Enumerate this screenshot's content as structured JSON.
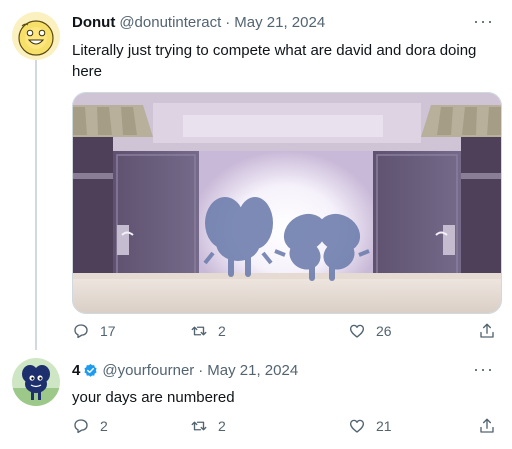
{
  "tweets": [
    {
      "name": "Donut",
      "handle": "@donutinteract",
      "sep": "·",
      "date": "May 21, 2024",
      "text": "Literally just trying to compete what are david and dora doing here",
      "replies": "17",
      "retweets": "2",
      "likes": "26"
    },
    {
      "name": "4",
      "handle": "@yourfourner",
      "sep": "·",
      "date": "May 21, 2024",
      "text": "your days are numbered",
      "replies": "2",
      "retweets": "2",
      "likes": "21"
    }
  ],
  "more_label": "···",
  "colors": {
    "text": "#0f1419",
    "secondary": "#536471",
    "verified": "#1d9bf0",
    "border": "#cfd9de"
  },
  "icons": [
    "reply-icon",
    "retweet-icon",
    "like-icon",
    "share-icon",
    "verified-badge-icon",
    "more-icon"
  ]
}
